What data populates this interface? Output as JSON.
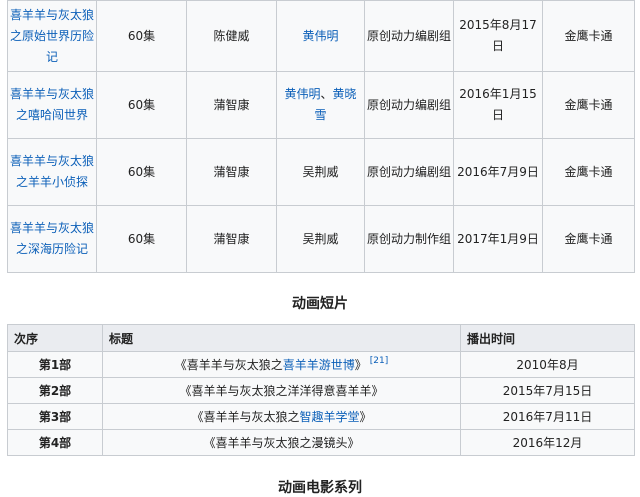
{
  "series": [
    {
      "title": "喜羊羊与灰太狼之原始世界历险记",
      "episodes": "60集",
      "director": "陈健威",
      "writer": "黄伟明",
      "writer_link": true,
      "writer2": "",
      "studio": "原创动力编剧组",
      "date": "2015年8月17日",
      "tv": "金鹰卡通"
    },
    {
      "title": "喜羊羊与灰太狼之嘻哈闯世界",
      "episodes": "60集",
      "director": "蒲智康",
      "writer": "黄伟明",
      "writer_link": true,
      "writer2": "黄晓雪",
      "studio": "原创动力编剧组",
      "date": "2016年1月15日",
      "tv": "金鹰卡通"
    },
    {
      "title": "喜羊羊与灰太狼之羊羊小侦探",
      "episodes": "60集",
      "director": "蒲智康",
      "writer": "吴荆威",
      "writer_link": false,
      "writer2": "",
      "studio": "原创动力编剧组",
      "date": "2016年7月9日",
      "tv": "金鹰卡通"
    },
    {
      "title": "喜羊羊与灰太狼之深海历险记",
      "episodes": "60集",
      "director": "蒲智康",
      "writer": "吴荆威",
      "writer_link": false,
      "writer2": "",
      "studio": "原创动力制作组",
      "date": "2017年1月9日",
      "tv": "金鹰卡通"
    }
  ],
  "shorts": {
    "heading": "动画短片",
    "columns": [
      "次序",
      "标题",
      "播出时间"
    ],
    "rows": [
      {
        "order": "第1部",
        "title_prefix": "《喜羊羊与灰太狼之",
        "title_link": "喜羊羊游世博",
        "title_suffix": "》",
        "ref": "[21]",
        "date": "2010年8月"
      },
      {
        "order": "第2部",
        "title_prefix": "《喜羊羊与灰太狼之洋洋得意喜羊羊》",
        "title_link": "",
        "title_suffix": "",
        "ref": "",
        "date": "2015年7月15日"
      },
      {
        "order": "第3部",
        "title_prefix": "《喜羊羊与灰太狼之",
        "title_link": "智趣羊学堂",
        "title_suffix": "》",
        "ref": "",
        "date": "2016年7月11日"
      },
      {
        "order": "第4部",
        "title_prefix": "《喜羊羊与灰太狼之漫镜头》",
        "title_link": "",
        "title_suffix": "",
        "ref": "",
        "date": "2016年12月"
      }
    ]
  },
  "next_heading": "动画电影系列"
}
